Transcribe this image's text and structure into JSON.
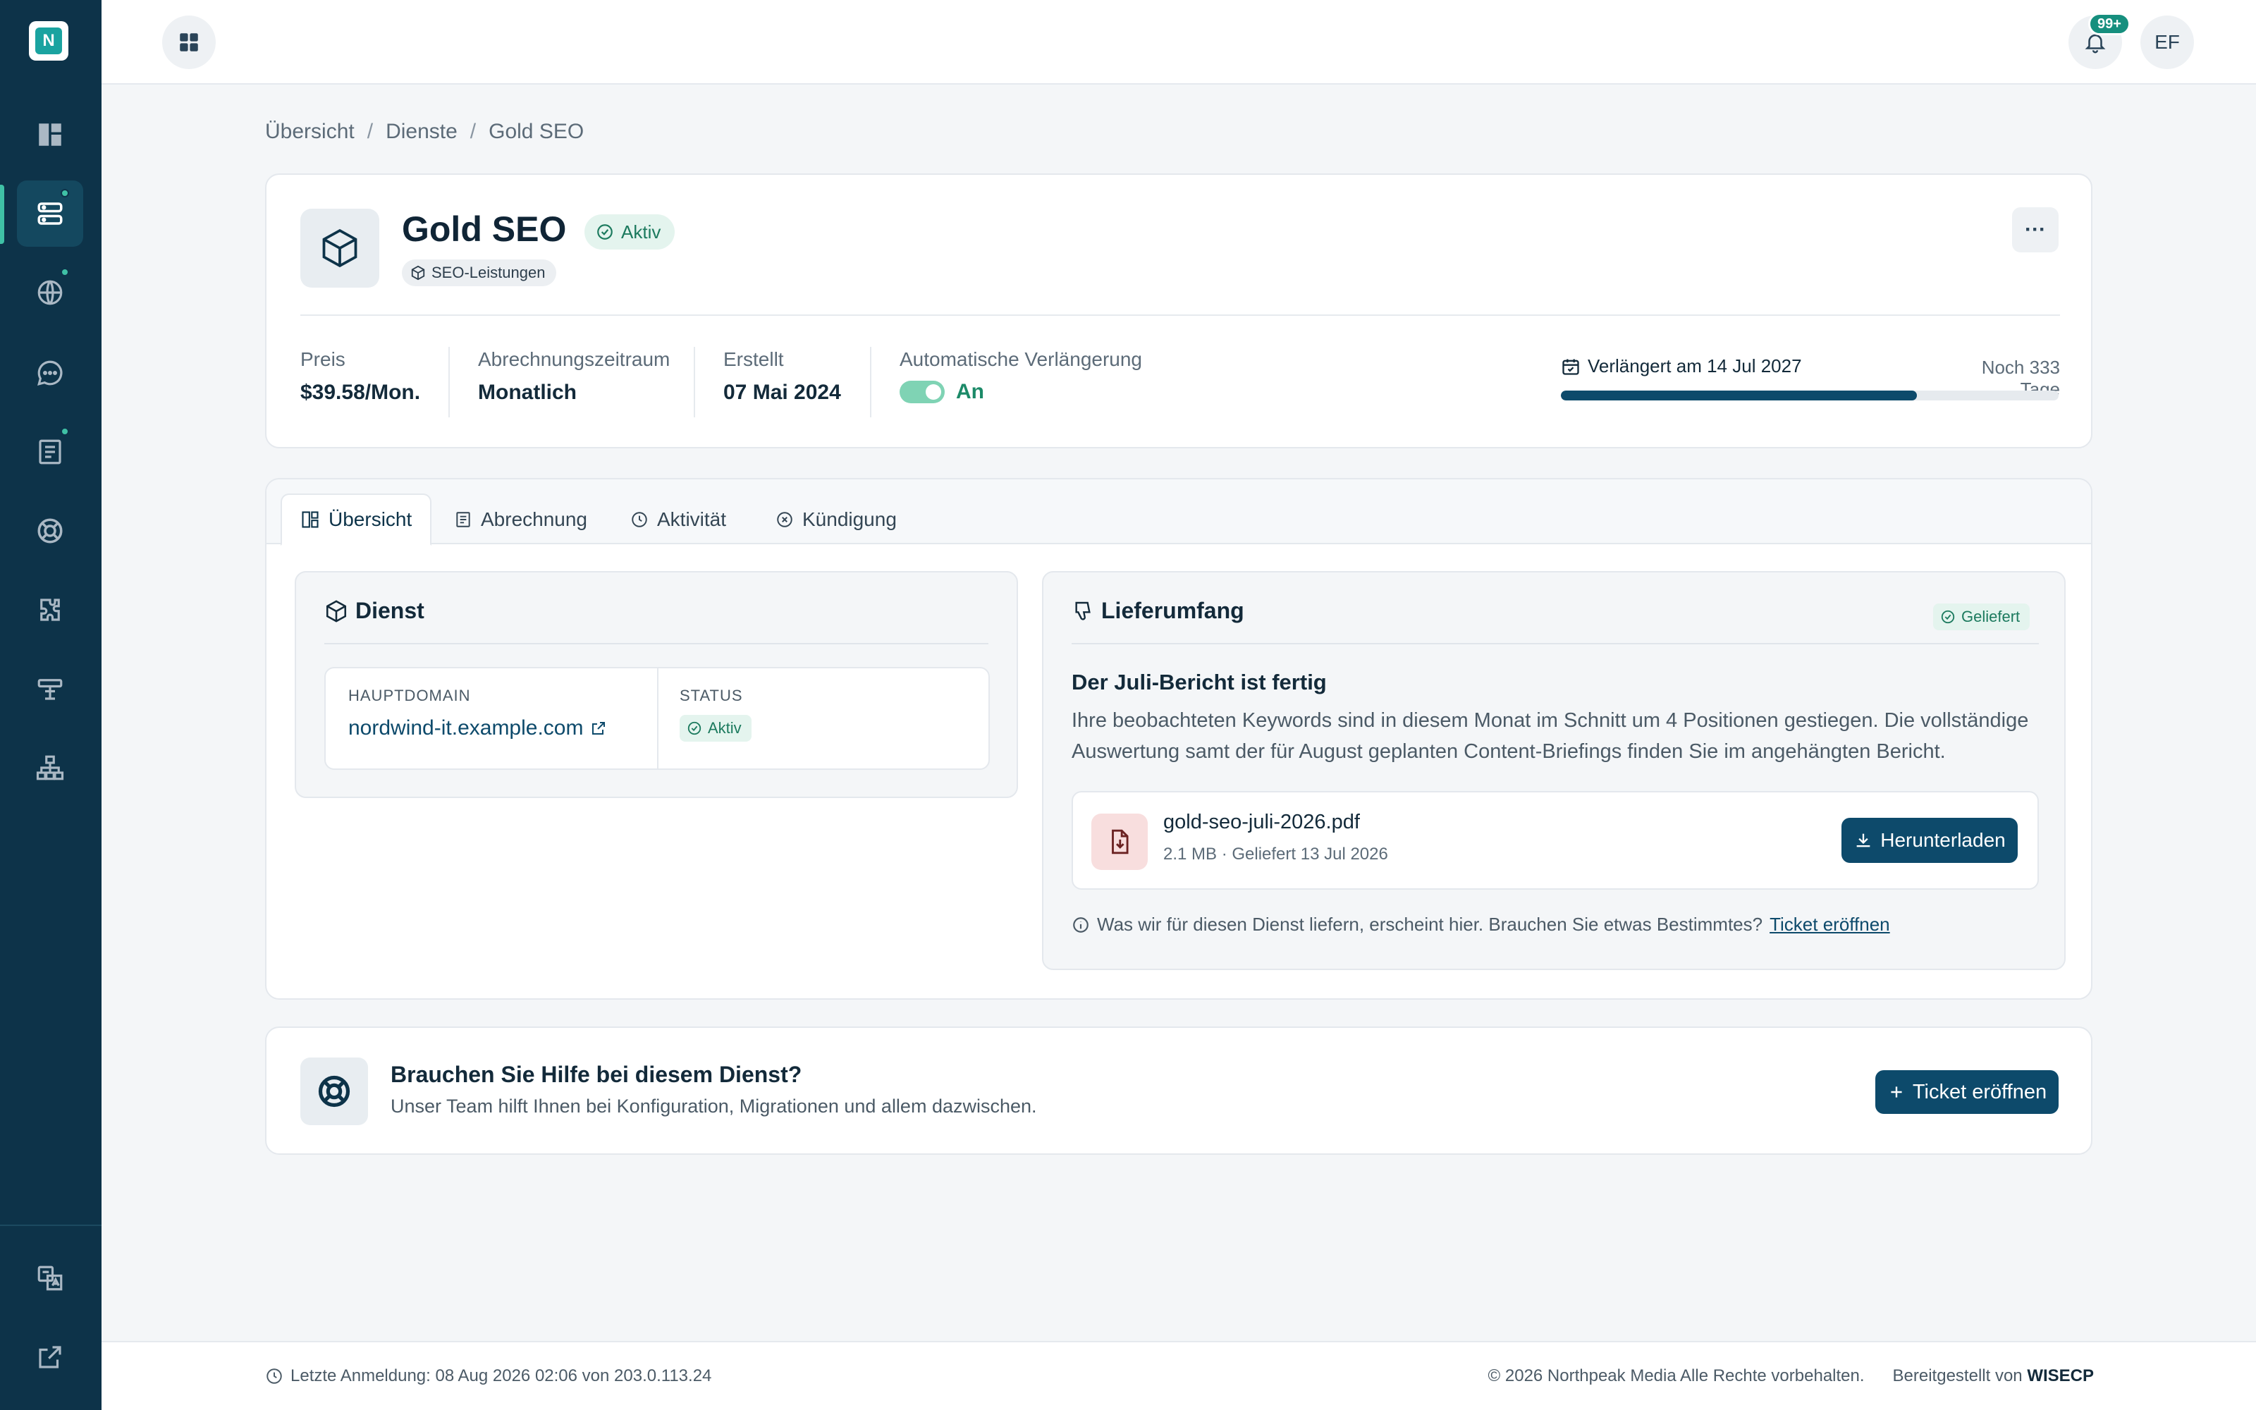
{
  "sidebar": {
    "logo_letter": "N",
    "items": [
      {
        "name": "dashboard",
        "icon": "dashboard-icon"
      },
      {
        "name": "services",
        "icon": "server-icon",
        "active": true,
        "dot": true
      },
      {
        "name": "domains",
        "icon": "globe-icon",
        "dot": true
      },
      {
        "name": "messages",
        "icon": "chat-icon"
      },
      {
        "name": "invoices",
        "icon": "invoice-icon",
        "dot": true
      },
      {
        "name": "support",
        "icon": "lifebuoy-icon"
      },
      {
        "name": "addons",
        "icon": "puzzle-icon"
      },
      {
        "name": "settings",
        "icon": "signpost-icon"
      },
      {
        "name": "affiliates",
        "icon": "network-icon"
      }
    ],
    "bottom_items": [
      {
        "name": "language",
        "icon": "translate-icon"
      },
      {
        "name": "logout",
        "icon": "external-link-icon"
      }
    ]
  },
  "topbar": {
    "notification_badge": "99+",
    "avatar_initials": "EF"
  },
  "breadcrumb": [
    "Übersicht",
    "Dienste",
    "Gold SEO"
  ],
  "service": {
    "title": "Gold SEO",
    "status": "Aktiv",
    "category": "SEO-Leistungen",
    "more_label": "···",
    "price_label": "Preis",
    "price_value": "$39.58/Mon.",
    "billing_label": "Abrechnungszeitraum",
    "billing_value": "Monatlich",
    "created_label": "Erstellt",
    "created_value": "07 Mai 2024",
    "autorenew_label": "Automatische Verlängerung",
    "autorenew_value": "An",
    "renew_text": "Verlängert am 14 Jul 2027",
    "renew_days": "Noch 333 Tage",
    "renew_progress": 0.715
  },
  "tabs": [
    {
      "label": "Übersicht",
      "icon": "layout-icon",
      "active": true
    },
    {
      "label": "Abrechnung",
      "icon": "receipt-icon"
    },
    {
      "label": "Aktivität",
      "icon": "clock-icon"
    },
    {
      "label": "Kündigung",
      "icon": "cancel-circle-icon"
    }
  ],
  "dienst": {
    "title": "Dienst",
    "domain_label": "HAUPTDOMAIN",
    "domain_value": "nordwind-it.example.com",
    "status_label": "STATUS",
    "status_value": "Aktiv"
  },
  "lieferumfang": {
    "title": "Lieferumfang",
    "badge": "Geliefert",
    "report_title": "Der Juli-Bericht ist fertig",
    "report_text": "Ihre beobachteten Keywords sind in diesem Monat im Schnitt um 4 Positionen gestiegen. Die vollständige Auswertung samt der für August geplanten Content-Briefings finden Sie im angehängten Bericht.",
    "file_name": "gold-seo-juli-2026.pdf",
    "file_meta": "2.1 MB · Geliefert 13 Jul 2026",
    "download_label": "Herunterladen",
    "note": "Was wir für diesen Dienst liefern, erscheint hier. Brauchen Sie etwas Bestimmtes?",
    "note_link": "Ticket eröffnen"
  },
  "help": {
    "title": "Brauchen Sie Hilfe bei diesem Dienst?",
    "subtitle": "Unser Team hilft Ihnen bei Konfiguration, Migrationen und allem dazwischen.",
    "button": "Ticket eröffnen"
  },
  "footer": {
    "last_login": "Letzte Anmeldung: 08 Aug 2026 02:06 von 203.0.113.24",
    "copyright": "© 2026 Northpeak Media Alle Rechte vorbehalten.",
    "powered_prefix": "Bereitgestellt von",
    "powered_brand": "WISECP"
  },
  "colors": {
    "sidebar": "#0d3349",
    "accent": "#0d4a6b",
    "success": "#1c7a5e",
    "dot": "#3fc1a6"
  }
}
